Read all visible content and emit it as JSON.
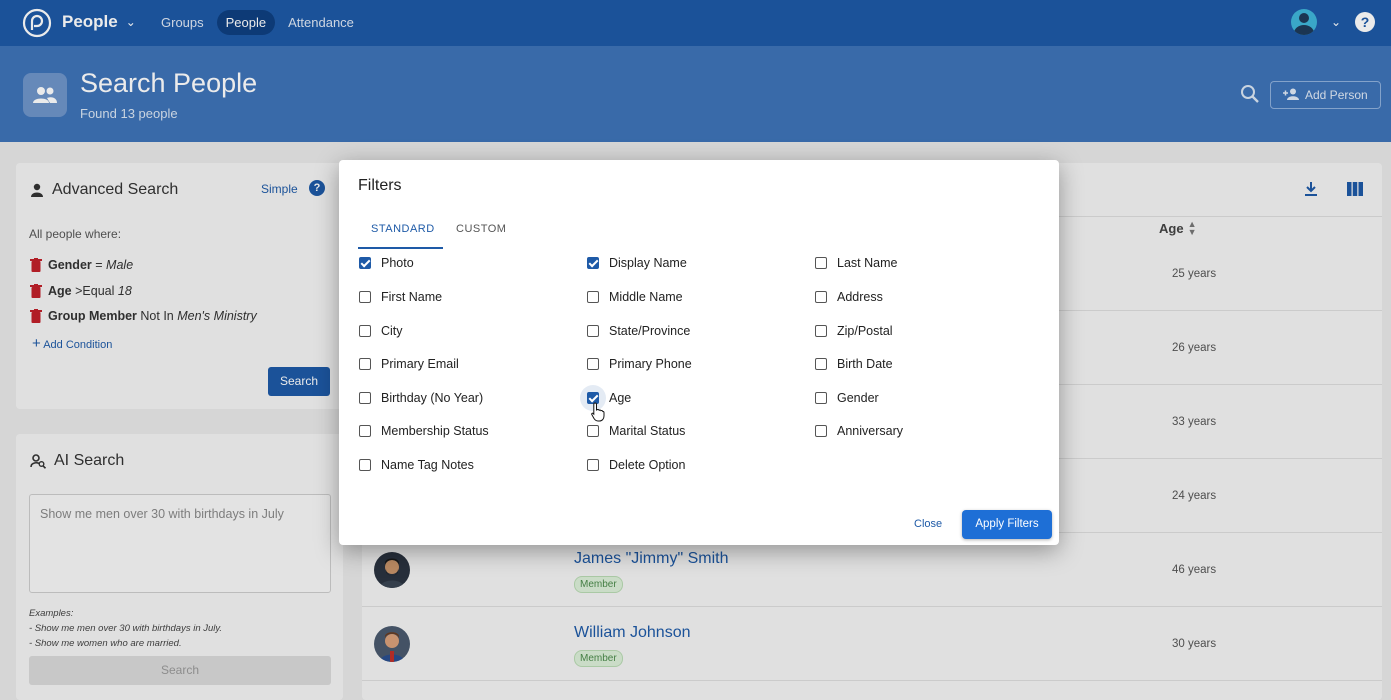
{
  "topnav": {
    "app_name": "People",
    "links": [
      "Groups",
      "People",
      "Attendance"
    ],
    "active_link": "People"
  },
  "header": {
    "title": "Search People",
    "subtitle": "Found 13 people",
    "add_person": "Add Person"
  },
  "advanced": {
    "title": "Advanced Search",
    "simple_link": "Simple",
    "all_people": "All people where:",
    "conditions": [
      {
        "field": "Gender",
        "op": "=",
        "value": "Male"
      },
      {
        "field": "Age",
        "op": ">Equal",
        "value": "18"
      },
      {
        "field": "Group Member",
        "op": "Not In",
        "value": "Men's Ministry"
      }
    ],
    "add_condition": "Add Condition",
    "search_label": "Search"
  },
  "ai": {
    "title": "AI Search",
    "placeholder": "Show me men over 30 with birthdays in July",
    "examples_title": "Examples:",
    "example_1": "- Show me men over 30 with birthdays in July.",
    "example_2": "- Show me women who are married.",
    "search_label": "Search"
  },
  "results": {
    "age_header": "Age",
    "ages": [
      "25 years",
      "26 years",
      "33 years",
      "24 years",
      "46 years",
      "30 years"
    ],
    "people": [
      {
        "name": "James \"Jimmy\" Smith",
        "badge": "Member"
      },
      {
        "name": "William Johnson",
        "badge": "Member"
      }
    ]
  },
  "modal": {
    "title": "Filters",
    "tab_standard": "STANDARD",
    "tab_custom": "CUSTOM",
    "options": [
      {
        "label": "Photo",
        "checked": true
      },
      {
        "label": "Display Name",
        "checked": true
      },
      {
        "label": "Last Name",
        "checked": false
      },
      {
        "label": "First Name",
        "checked": false
      },
      {
        "label": "Middle Name",
        "checked": false
      },
      {
        "label": "Address",
        "checked": false
      },
      {
        "label": "City",
        "checked": false
      },
      {
        "label": "State/Province",
        "checked": false
      },
      {
        "label": "Zip/Postal",
        "checked": false
      },
      {
        "label": "Primary Email",
        "checked": false
      },
      {
        "label": "Primary Phone",
        "checked": false
      },
      {
        "label": "Birth Date",
        "checked": false
      },
      {
        "label": "Birthday (No Year)",
        "checked": false
      },
      {
        "label": "Age",
        "checked": true
      },
      {
        "label": "Gender",
        "checked": false
      },
      {
        "label": "Membership Status",
        "checked": false
      },
      {
        "label": "Marital Status",
        "checked": false
      },
      {
        "label": "Anniversary",
        "checked": false
      },
      {
        "label": "Name Tag Notes",
        "checked": false
      },
      {
        "label": "Delete Option",
        "checked": false
      }
    ],
    "close_label": "Close",
    "apply_label": "Apply Filters"
  },
  "colors": {
    "nav": "#1e5aa7",
    "header": "#3e73b8",
    "accent": "#1e6fd6",
    "trash": "#c0202a"
  }
}
